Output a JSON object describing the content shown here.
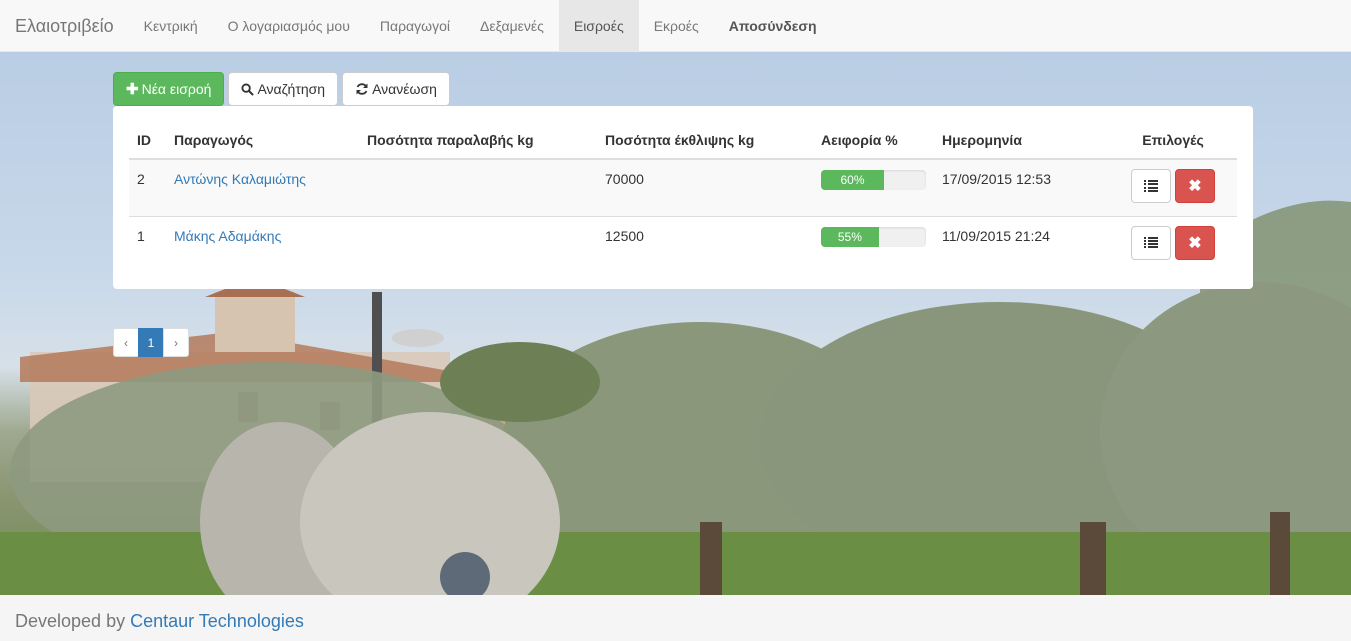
{
  "navbar": {
    "brand": "Ελαιοτριβείο",
    "items": [
      {
        "label": "Κεντρική"
      },
      {
        "label": "Ο λογαριασμός μου"
      },
      {
        "label": "Παραγωγοί"
      },
      {
        "label": "Δεξαμενές"
      },
      {
        "label": "Εισροές"
      },
      {
        "label": "Εκροές"
      },
      {
        "label": "Αποσύνδεση"
      }
    ],
    "active": "Εισροές"
  },
  "toolbar": {
    "new_label": "Νέα εισροή",
    "new_icon": "plus-icon",
    "search_label": "Αναζήτηση",
    "search_icon": "search-icon",
    "refresh_label": "Ανανέωση",
    "refresh_icon": "refresh-icon"
  },
  "table": {
    "headers": [
      "ID",
      "Παραγωγός",
      "Ποσότητα παραλαβής kg",
      "Ποσότητα έκθλιψης kg",
      "Αειφορία %",
      "Ημερομηνία",
      "Επιλογές"
    ],
    "rows": [
      {
        "id": "2",
        "producer": "Αντώνης Καλαμιώτης",
        "received": "",
        "pressed": "70000",
        "yield_label": "60%",
        "yield_value": 60,
        "date": "17/09/2015 12:53"
      },
      {
        "id": "1",
        "producer": "Μάκης Αδαμάκης",
        "received": "",
        "pressed": "12500",
        "yield_label": "55%",
        "yield_value": 55,
        "date": "11/09/2015 21:24"
      }
    ]
  },
  "pagination": {
    "prev": "‹",
    "current": "1",
    "next": "›"
  },
  "footer": {
    "prefix": "Developed by ",
    "link": "Centaur Technologies"
  },
  "colors": {
    "success": "#5cb85c",
    "danger": "#d9534f",
    "primary": "#337ab7"
  }
}
